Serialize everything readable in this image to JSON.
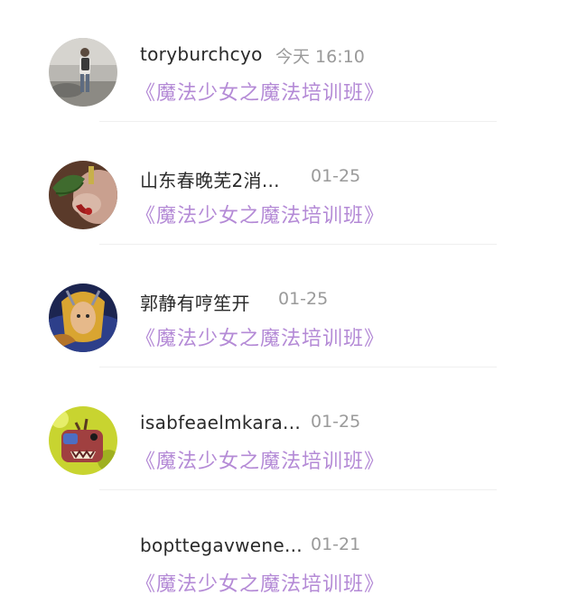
{
  "comments": [
    {
      "user": "toryburchcyo",
      "time": "今天 16:10",
      "work_title": "《魔法少女之魔法培训班》",
      "avatar_icon": "person-walking-avatar-icon"
    },
    {
      "user": "山东春晚芜2消...",
      "time": "01-25",
      "work_title": "《魔法少女之魔法培训班》",
      "avatar_icon": "hand-with-leaf-avatar-icon"
    },
    {
      "user": "郭静有哼笙开",
      "time": "01-25",
      "work_title": "《魔法少女之魔法培训班》",
      "avatar_icon": "fantasy-elf-avatar-icon"
    },
    {
      "user": "isabfeaelmkara...",
      "time": "01-25",
      "work_title": "《魔法少女之魔法培训班》",
      "avatar_icon": "cartoon-monster-avatar-icon"
    },
    {
      "user": "bopttegavwene...",
      "time": "01-21",
      "work_title": "《魔法少女之魔法培训班》",
      "avatar_icon": "blank-avatar-icon"
    }
  ],
  "colors": {
    "title_purple": "#b48ad6",
    "name_text": "#2a2a2a",
    "time_text": "#9a9a9a",
    "divider": "#efefef"
  }
}
